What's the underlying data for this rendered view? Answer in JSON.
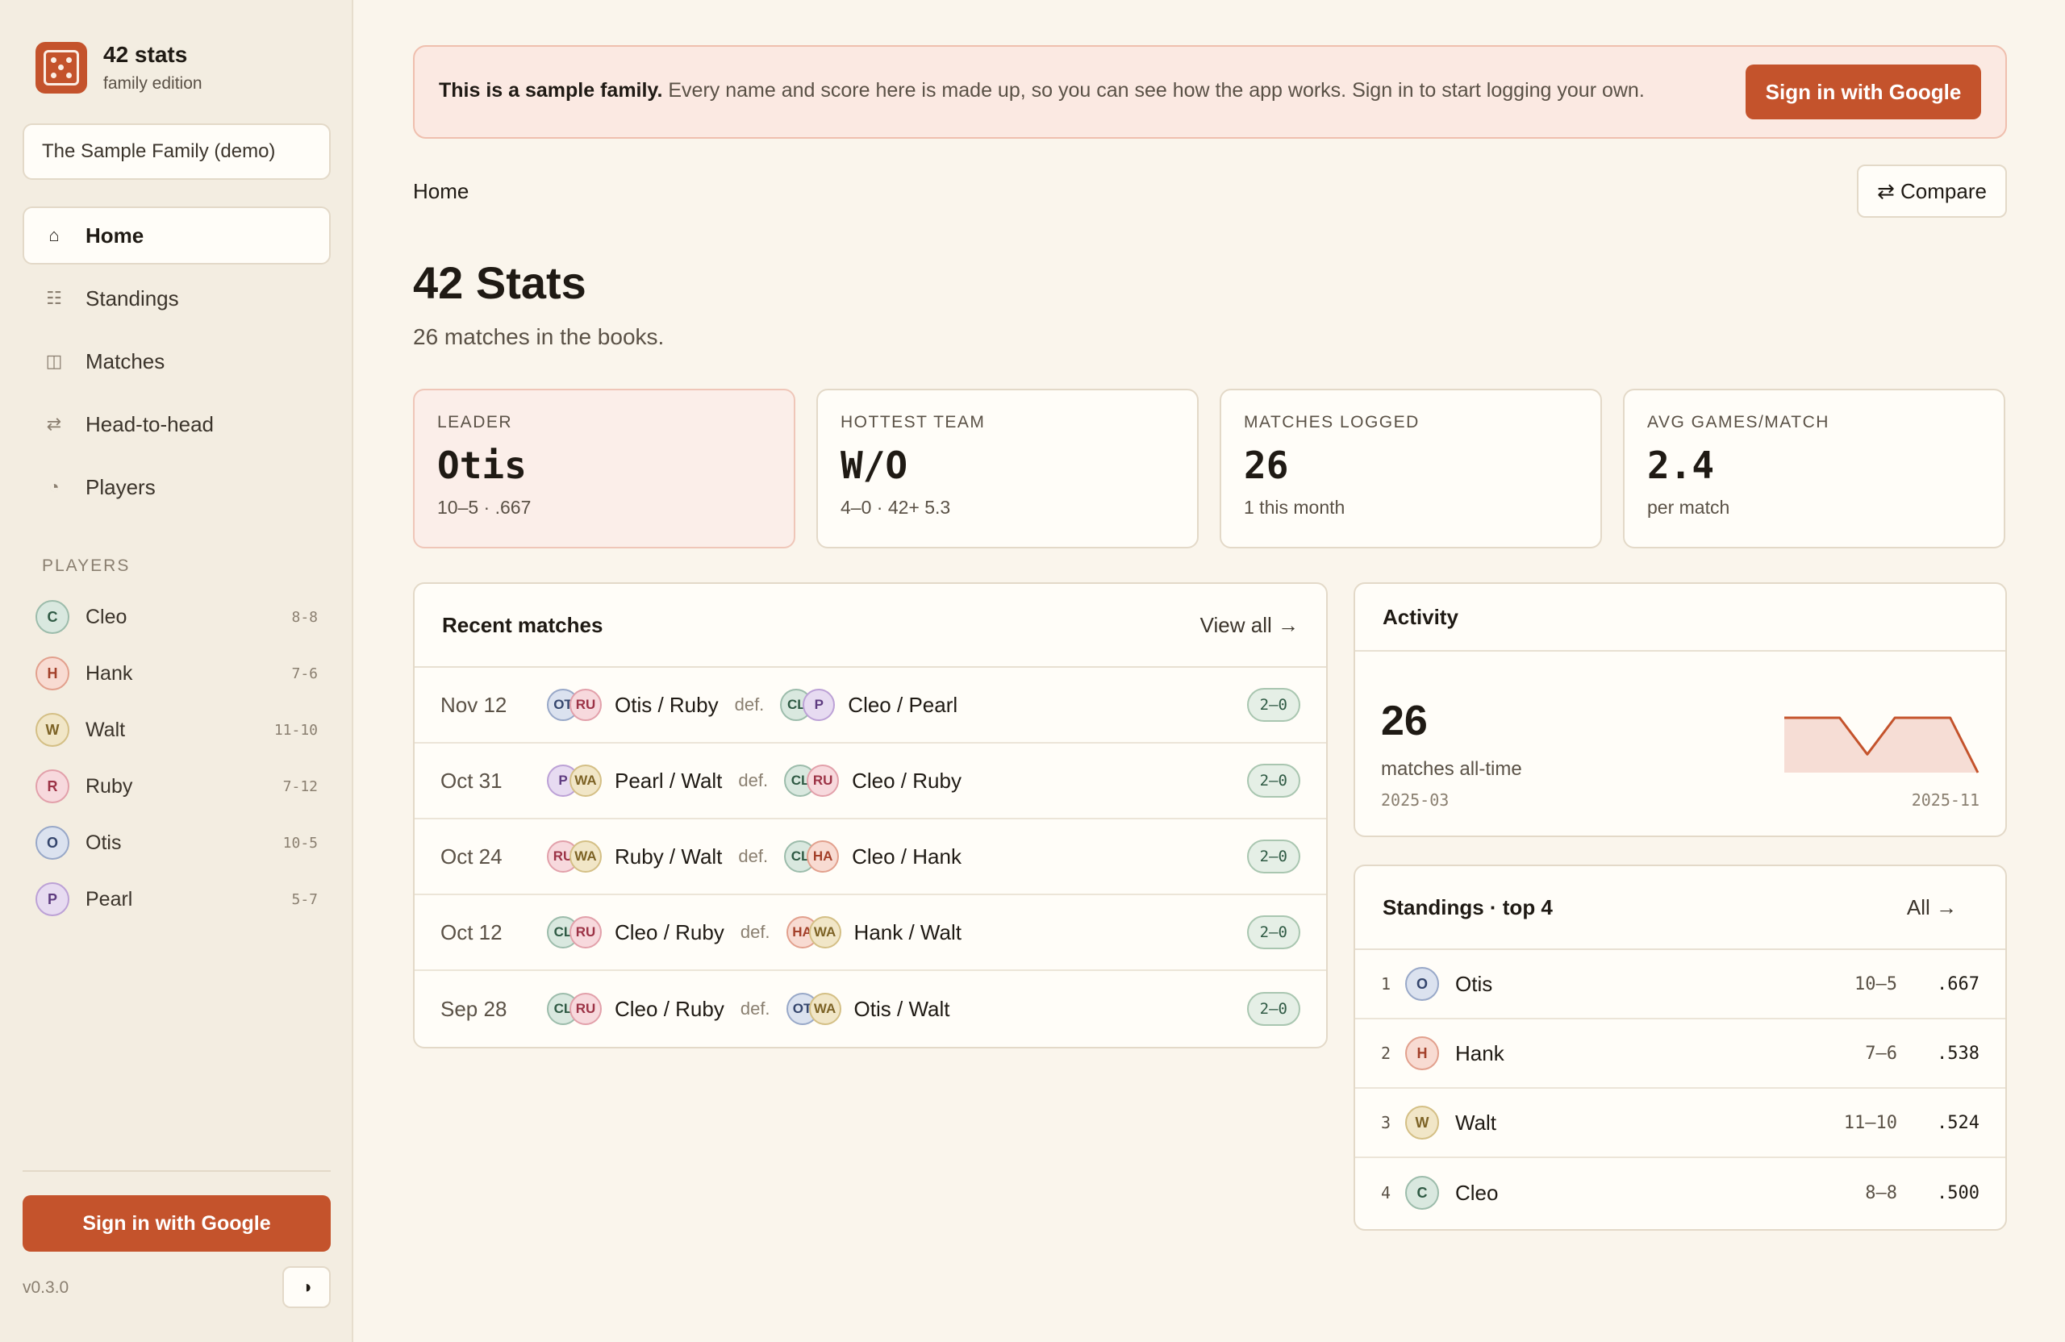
{
  "brand": {
    "title": "42 stats",
    "subtitle": "family edition"
  },
  "family_select": {
    "value": "The Sample Family (demo)"
  },
  "nav": [
    {
      "label": "Home",
      "icon": "home-icon",
      "glyph": "⌂",
      "active": true
    },
    {
      "label": "Standings",
      "icon": "list-icon",
      "glyph": "☷",
      "active": false
    },
    {
      "label": "Matches",
      "icon": "book-icon",
      "glyph": "◫",
      "active": false
    },
    {
      "label": "Head-to-head",
      "icon": "swap-icon",
      "glyph": "⇄",
      "active": false
    },
    {
      "label": "Players",
      "icon": "pie-icon",
      "glyph": "◔",
      "active": false
    }
  ],
  "players_heading": "PLAYERS",
  "players": [
    {
      "name": "Cleo",
      "initial": "C",
      "record": "8-8",
      "color": "cleo"
    },
    {
      "name": "Hank",
      "initial": "H",
      "record": "7-6",
      "color": "hank"
    },
    {
      "name": "Walt",
      "initial": "W",
      "record": "11-10",
      "color": "walt"
    },
    {
      "name": "Ruby",
      "initial": "R",
      "record": "7-12",
      "color": "ruby"
    },
    {
      "name": "Otis",
      "initial": "O",
      "record": "10-5",
      "color": "otis"
    },
    {
      "name": "Pearl",
      "initial": "P",
      "record": "5-7",
      "color": "pearl"
    }
  ],
  "sidebar_footer": {
    "signin_label": "Sign in with Google",
    "version": "v0.3.0",
    "theme_glyph": "◑"
  },
  "banner": {
    "bold": "This is a sample family.",
    "text": " Every name and score here is made up, so you can see how the app works. Sign in to start logging your own.",
    "button": "Sign in with Google"
  },
  "breadcrumb": "Home",
  "compare_label": "⇄ Compare",
  "page": {
    "title": "42 Stats",
    "subtitle": "26 matches in the books."
  },
  "stats": [
    {
      "label": "LEADER",
      "value": "Otis",
      "sub": "10–5 · .667",
      "highlight": true
    },
    {
      "label": "HOTTEST TEAM",
      "value": "W/O",
      "sub": "4–0 · 42+ 5.3",
      "highlight": false
    },
    {
      "label": "MATCHES LOGGED",
      "value": "26",
      "sub": "1 this month",
      "highlight": false
    },
    {
      "label": "AVG GAMES/MATCH",
      "value": "2.4",
      "sub": "per match",
      "highlight": false
    }
  ],
  "recent": {
    "title": "Recent matches",
    "view_all": "View all →",
    "def_label": "def.",
    "rows": [
      {
        "date": "Nov 12",
        "winners": "Otis / Ruby",
        "w_av": [
          [
            "OT",
            "otis"
          ],
          [
            "RU",
            "ruby"
          ]
        ],
        "losers": "Cleo / Pearl",
        "l_av": [
          [
            "CL",
            "cleo"
          ],
          [
            "P",
            "pearl"
          ]
        ],
        "score": "2–0"
      },
      {
        "date": "Oct 31",
        "winners": "Pearl / Walt",
        "w_av": [
          [
            "P",
            "pearl"
          ],
          [
            "WA",
            "walt"
          ]
        ],
        "losers": "Cleo / Ruby",
        "l_av": [
          [
            "CL",
            "cleo"
          ],
          [
            "RU",
            "ruby"
          ]
        ],
        "score": "2–0"
      },
      {
        "date": "Oct 24",
        "winners": "Ruby / Walt",
        "w_av": [
          [
            "RU",
            "ruby"
          ],
          [
            "WA",
            "walt"
          ]
        ],
        "losers": "Cleo / Hank",
        "l_av": [
          [
            "CL",
            "cleo"
          ],
          [
            "HA",
            "hank"
          ]
        ],
        "score": "2–0"
      },
      {
        "date": "Oct 12",
        "winners": "Cleo / Ruby",
        "w_av": [
          [
            "CL",
            "cleo"
          ],
          [
            "RU",
            "ruby"
          ]
        ],
        "losers": "Hank / Walt",
        "l_av": [
          [
            "HA",
            "hank"
          ],
          [
            "WA",
            "walt"
          ]
        ],
        "score": "2–0"
      },
      {
        "date": "Sep 28",
        "winners": "Cleo / Ruby",
        "w_av": [
          [
            "CL",
            "cleo"
          ],
          [
            "RU",
            "ruby"
          ]
        ],
        "losers": "Otis / Walt",
        "l_av": [
          [
            "OT",
            "otis"
          ],
          [
            "WA",
            "walt"
          ]
        ],
        "score": "2–0"
      }
    ]
  },
  "activity": {
    "title": "Activity",
    "count": "26",
    "label": "matches all-time",
    "start": "2025-03",
    "end": "2025-11",
    "spark_levels": [
      3,
      3,
      3,
      1,
      3,
      3,
      3,
      0
    ],
    "stroke": "#c4532c",
    "fill": "#f6ddd5"
  },
  "standings": {
    "title": "Standings · top 4",
    "all_link": "All →",
    "rows": [
      {
        "rank": "1",
        "name": "Otis",
        "initial": "O",
        "color": "otis",
        "record": "10–5",
        "pct": ".667"
      },
      {
        "rank": "2",
        "name": "Hank",
        "initial": "H",
        "color": "hank",
        "record": "7–6",
        "pct": ".538"
      },
      {
        "rank": "3",
        "name": "Walt",
        "initial": "W",
        "color": "walt",
        "record": "11–10",
        "pct": ".524"
      },
      {
        "rank": "4",
        "name": "Cleo",
        "initial": "C",
        "color": "cleo",
        "record": "8–8",
        "pct": ".500"
      }
    ]
  }
}
